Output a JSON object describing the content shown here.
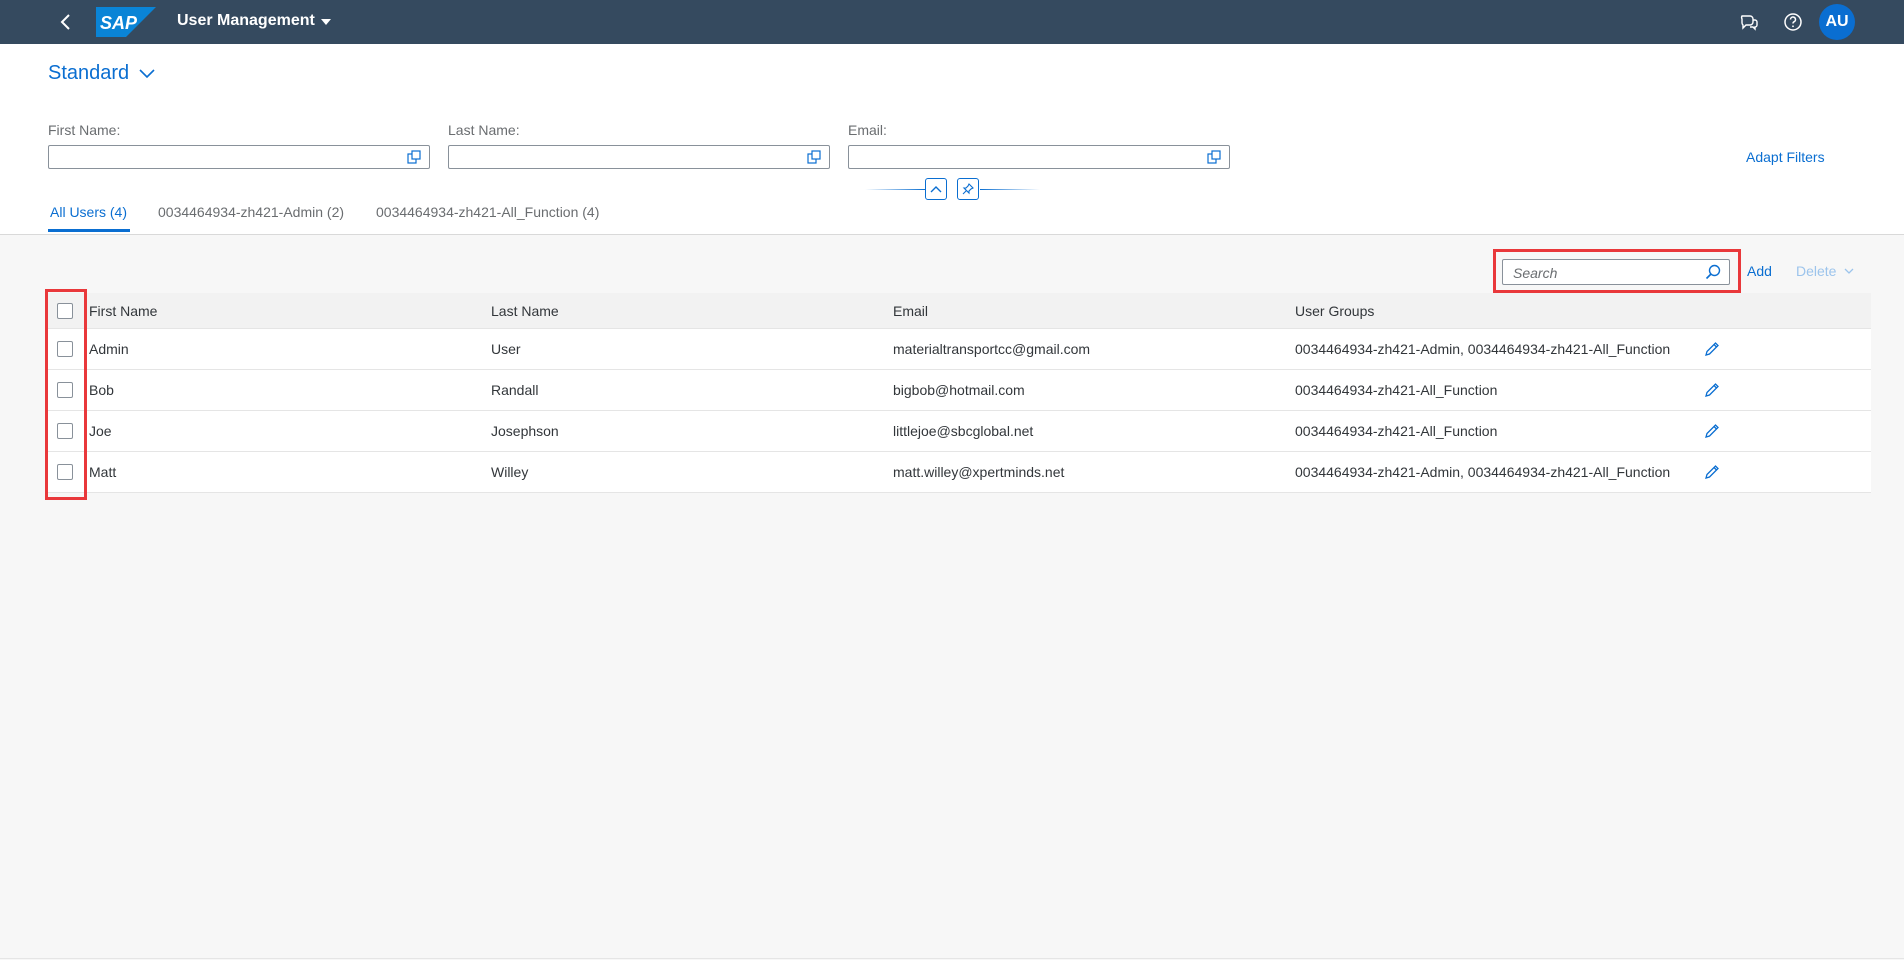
{
  "shell": {
    "back_icon": "chevron-left-icon",
    "logo_text": "SAP",
    "app_title": "User Management",
    "icons": [
      "feedback-icon",
      "help-icon"
    ],
    "avatar_initials": "AU",
    "bar_color": "#354a5f"
  },
  "header": {
    "variant": "Standard",
    "filters": [
      {
        "label": "First Name:",
        "value": ""
      },
      {
        "label": "Last Name:",
        "value": ""
      },
      {
        "label": "Email:",
        "value": ""
      }
    ],
    "adapt_filters": "Adapt Filters"
  },
  "tabs": [
    {
      "label": "All Users (4)",
      "active": true
    },
    {
      "label": "0034464934-zh421-Admin (2)",
      "active": false
    },
    {
      "label": "0034464934-zh421-All_Function (4)",
      "active": false
    }
  ],
  "toolbar": {
    "search_placeholder": "Search",
    "add_label": "Add",
    "delete_label": "Delete"
  },
  "table": {
    "columns": [
      "First Name",
      "Last Name",
      "Email",
      "User Groups"
    ],
    "rows": [
      {
        "first": "Admin",
        "last": "User",
        "email": "materialtransportcc@gmail.com",
        "groups": "0034464934-zh421-Admin, 0034464934-zh421-All_Function"
      },
      {
        "first": "Bob",
        "last": "Randall",
        "email": "bigbob@hotmail.com",
        "groups": "0034464934-zh421-All_Function"
      },
      {
        "first": "Joe",
        "last": "Josephson",
        "email": "littlejoe@sbcglobal.net",
        "groups": "0034464934-zh421-All_Function"
      },
      {
        "first": "Matt",
        "last": "Willey",
        "email": "matt.willey@xpertminds.net",
        "groups": "0034464934-zh421-Admin, 0034464934-zh421-All_Function"
      }
    ]
  },
  "colors": {
    "accent": "#0a6ed1",
    "highlight": "#e9383b"
  }
}
